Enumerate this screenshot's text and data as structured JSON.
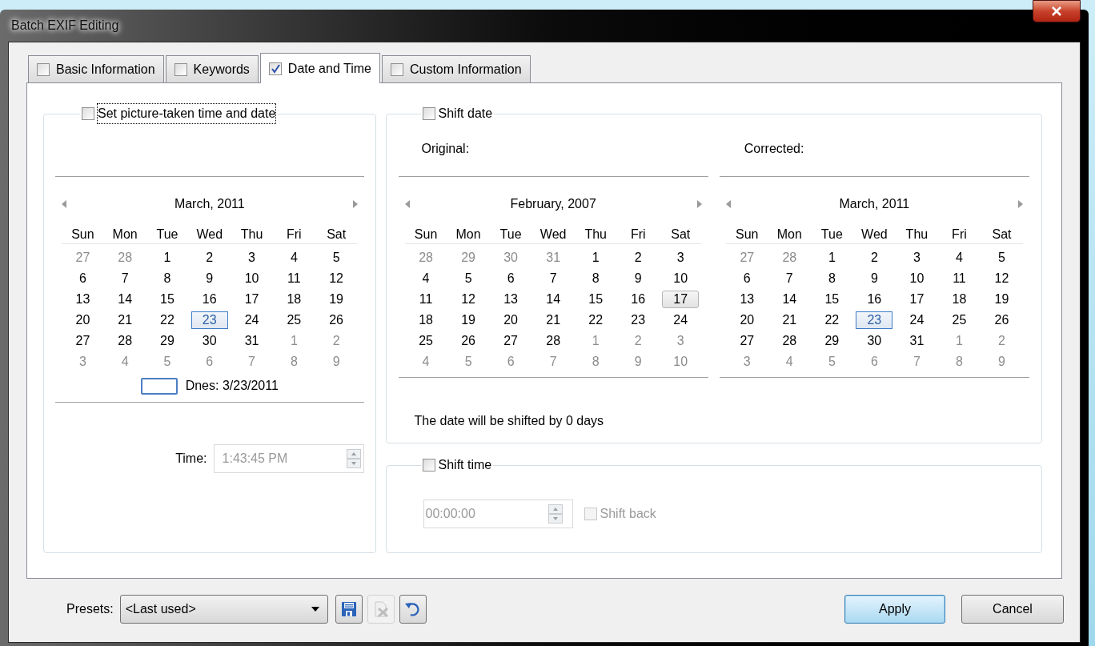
{
  "window": {
    "title": "Batch EXIF Editing"
  },
  "tabs": [
    {
      "label": "Basic Information",
      "checked": false,
      "selected": false
    },
    {
      "label": "Keywords",
      "checked": false,
      "selected": false
    },
    {
      "label": "Date and Time",
      "checked": true,
      "selected": true
    },
    {
      "label": "Custom Information",
      "checked": false,
      "selected": false
    }
  ],
  "set_date_group": {
    "label": "Set picture-taken time and date",
    "checked": false,
    "focused": true,
    "calendar": {
      "title": "March, 2011",
      "weekdays": [
        "Sun",
        "Mon",
        "Tue",
        "Wed",
        "Thu",
        "Fri",
        "Sat"
      ],
      "today_label": "Dnes: 3/23/2011",
      "weeks": [
        [
          {
            "text": "27",
            "muted": true,
            "selected": false,
            "today": false
          },
          {
            "text": "28",
            "muted": true,
            "selected": false,
            "today": false
          },
          {
            "text": "1",
            "muted": false,
            "selected": false,
            "today": false
          },
          {
            "text": "2",
            "muted": false,
            "selected": false,
            "today": false
          },
          {
            "text": "3",
            "muted": false,
            "selected": false,
            "today": false
          },
          {
            "text": "4",
            "muted": false,
            "selected": false,
            "today": false
          },
          {
            "text": "5",
            "muted": false,
            "selected": false,
            "today": false
          }
        ],
        [
          {
            "text": "6",
            "muted": false,
            "selected": false,
            "today": false
          },
          {
            "text": "7",
            "muted": false,
            "selected": false,
            "today": false
          },
          {
            "text": "8",
            "muted": false,
            "selected": false,
            "today": false
          },
          {
            "text": "9",
            "muted": false,
            "selected": false,
            "today": false
          },
          {
            "text": "10",
            "muted": false,
            "selected": false,
            "today": false
          },
          {
            "text": "11",
            "muted": false,
            "selected": false,
            "today": false
          },
          {
            "text": "12",
            "muted": false,
            "selected": false,
            "today": false
          }
        ],
        [
          {
            "text": "13",
            "muted": false,
            "selected": false,
            "today": false
          },
          {
            "text": "14",
            "muted": false,
            "selected": false,
            "today": false
          },
          {
            "text": "15",
            "muted": false,
            "selected": false,
            "today": false
          },
          {
            "text": "16",
            "muted": false,
            "selected": false,
            "today": false
          },
          {
            "text": "17",
            "muted": false,
            "selected": false,
            "today": false
          },
          {
            "text": "18",
            "muted": false,
            "selected": false,
            "today": false
          },
          {
            "text": "19",
            "muted": false,
            "selected": false,
            "today": false
          }
        ],
        [
          {
            "text": "20",
            "muted": false,
            "selected": false,
            "today": false
          },
          {
            "text": "21",
            "muted": false,
            "selected": false,
            "today": false
          },
          {
            "text": "22",
            "muted": false,
            "selected": false,
            "today": false
          },
          {
            "text": "23",
            "muted": false,
            "selected": true,
            "today": true
          },
          {
            "text": "24",
            "muted": false,
            "selected": false,
            "today": false
          },
          {
            "text": "25",
            "muted": false,
            "selected": false,
            "today": false
          },
          {
            "text": "26",
            "muted": false,
            "selected": false,
            "today": false
          }
        ],
        [
          {
            "text": "27",
            "muted": false,
            "selected": false,
            "today": false
          },
          {
            "text": "28",
            "muted": false,
            "selected": false,
            "today": false
          },
          {
            "text": "29",
            "muted": false,
            "selected": false,
            "today": false
          },
          {
            "text": "30",
            "muted": false,
            "selected": false,
            "today": false
          },
          {
            "text": "31",
            "muted": false,
            "selected": false,
            "today": false
          },
          {
            "text": "1",
            "muted": true,
            "selected": false,
            "today": false
          },
          {
            "text": "2",
            "muted": true,
            "selected": false,
            "today": false
          }
        ],
        [
          {
            "text": "3",
            "muted": true,
            "selected": false,
            "today": false
          },
          {
            "text": "4",
            "muted": true,
            "selected": false,
            "today": false
          },
          {
            "text": "5",
            "muted": true,
            "selected": false,
            "today": false
          },
          {
            "text": "6",
            "muted": true,
            "selected": false,
            "today": false
          },
          {
            "text": "7",
            "muted": true,
            "selected": false,
            "today": false
          },
          {
            "text": "8",
            "muted": true,
            "selected": false,
            "today": false
          },
          {
            "text": "9",
            "muted": true,
            "selected": false,
            "today": false
          }
        ]
      ]
    },
    "time": {
      "label": "Time:",
      "value": "1:43:45 PM",
      "disabled": true
    }
  },
  "shift_date_group": {
    "label": "Shift date",
    "checked": false,
    "original_label": "Original:",
    "corrected_label": "Corrected:",
    "original_calendar": {
      "title": "February, 2007",
      "weekdays": [
        "Sun",
        "Mon",
        "Tue",
        "Wed",
        "Thu",
        "Fri",
        "Sat"
      ],
      "weeks": [
        [
          {
            "text": "28",
            "muted": true,
            "selected": false,
            "today": false
          },
          {
            "text": "29",
            "muted": true,
            "selected": false,
            "today": false
          },
          {
            "text": "30",
            "muted": true,
            "selected": false,
            "today": false
          },
          {
            "text": "31",
            "muted": true,
            "selected": false,
            "today": false
          },
          {
            "text": "1",
            "muted": false,
            "selected": false,
            "today": false
          },
          {
            "text": "2",
            "muted": false,
            "selected": false,
            "today": false
          },
          {
            "text": "3",
            "muted": false,
            "selected": false,
            "today": false
          }
        ],
        [
          {
            "text": "4",
            "muted": false,
            "selected": false,
            "today": false
          },
          {
            "text": "5",
            "muted": false,
            "selected": false,
            "today": false
          },
          {
            "text": "6",
            "muted": false,
            "selected": false,
            "today": false
          },
          {
            "text": "7",
            "muted": false,
            "selected": false,
            "today": false
          },
          {
            "text": "8",
            "muted": false,
            "selected": false,
            "today": false
          },
          {
            "text": "9",
            "muted": false,
            "selected": false,
            "today": false
          },
          {
            "text": "10",
            "muted": false,
            "selected": false,
            "today": false
          }
        ],
        [
          {
            "text": "11",
            "muted": false,
            "selected": false,
            "today": false
          },
          {
            "text": "12",
            "muted": false,
            "selected": false,
            "today": false
          },
          {
            "text": "13",
            "muted": false,
            "selected": false,
            "today": false
          },
          {
            "text": "14",
            "muted": false,
            "selected": false,
            "today": false
          },
          {
            "text": "15",
            "muted": false,
            "selected": false,
            "today": false
          },
          {
            "text": "16",
            "muted": false,
            "selected": false,
            "today": false
          },
          {
            "text": "17",
            "muted": false,
            "selected": true,
            "today": false
          }
        ],
        [
          {
            "text": "18",
            "muted": false,
            "selected": false,
            "today": false
          },
          {
            "text": "19",
            "muted": false,
            "selected": false,
            "today": false
          },
          {
            "text": "20",
            "muted": false,
            "selected": false,
            "today": false
          },
          {
            "text": "21",
            "muted": false,
            "selected": false,
            "today": false
          },
          {
            "text": "22",
            "muted": false,
            "selected": false,
            "today": false
          },
          {
            "text": "23",
            "muted": false,
            "selected": false,
            "today": false
          },
          {
            "text": "24",
            "muted": false,
            "selected": false,
            "today": false
          }
        ],
        [
          {
            "text": "25",
            "muted": false,
            "selected": false,
            "today": false
          },
          {
            "text": "26",
            "muted": false,
            "selected": false,
            "today": false
          },
          {
            "text": "27",
            "muted": false,
            "selected": false,
            "today": false
          },
          {
            "text": "28",
            "muted": false,
            "selected": false,
            "today": false
          },
          {
            "text": "1",
            "muted": true,
            "selected": false,
            "today": false
          },
          {
            "text": "2",
            "muted": true,
            "selected": false,
            "today": false
          },
          {
            "text": "3",
            "muted": true,
            "selected": false,
            "today": false
          }
        ],
        [
          {
            "text": "4",
            "muted": true,
            "selected": false,
            "today": false
          },
          {
            "text": "5",
            "muted": true,
            "selected": false,
            "today": false
          },
          {
            "text": "6",
            "muted": true,
            "selected": false,
            "today": false
          },
          {
            "text": "7",
            "muted": true,
            "selected": false,
            "today": false
          },
          {
            "text": "8",
            "muted": true,
            "selected": false,
            "today": false
          },
          {
            "text": "9",
            "muted": true,
            "selected": false,
            "today": false
          },
          {
            "text": "10",
            "muted": true,
            "selected": false,
            "today": false
          }
        ]
      ]
    },
    "corrected_calendar": {
      "title": "March, 2011",
      "weekdays": [
        "Sun",
        "Mon",
        "Tue",
        "Wed",
        "Thu",
        "Fri",
        "Sat"
      ],
      "weeks": [
        [
          {
            "text": "27",
            "muted": true,
            "selected": false,
            "today": false
          },
          {
            "text": "28",
            "muted": true,
            "selected": false,
            "today": false
          },
          {
            "text": "1",
            "muted": false,
            "selected": false,
            "today": false
          },
          {
            "text": "2",
            "muted": false,
            "selected": false,
            "today": false
          },
          {
            "text": "3",
            "muted": false,
            "selected": false,
            "today": false
          },
          {
            "text": "4",
            "muted": false,
            "selected": false,
            "today": false
          },
          {
            "text": "5",
            "muted": false,
            "selected": false,
            "today": false
          }
        ],
        [
          {
            "text": "6",
            "muted": false,
            "selected": false,
            "today": false
          },
          {
            "text": "7",
            "muted": false,
            "selected": false,
            "today": false
          },
          {
            "text": "8",
            "muted": false,
            "selected": false,
            "today": false
          },
          {
            "text": "9",
            "muted": false,
            "selected": false,
            "today": false
          },
          {
            "text": "10",
            "muted": false,
            "selected": false,
            "today": false
          },
          {
            "text": "11",
            "muted": false,
            "selected": false,
            "today": false
          },
          {
            "text": "12",
            "muted": false,
            "selected": false,
            "today": false
          }
        ],
        [
          {
            "text": "13",
            "muted": false,
            "selected": false,
            "today": false
          },
          {
            "text": "14",
            "muted": false,
            "selected": false,
            "today": false
          },
          {
            "text": "15",
            "muted": false,
            "selected": false,
            "today": false
          },
          {
            "text": "16",
            "muted": false,
            "selected": false,
            "today": false
          },
          {
            "text": "17",
            "muted": false,
            "selected": false,
            "today": false
          },
          {
            "text": "18",
            "muted": false,
            "selected": false,
            "today": false
          },
          {
            "text": "19",
            "muted": false,
            "selected": false,
            "today": false
          }
        ],
        [
          {
            "text": "20",
            "muted": false,
            "selected": false,
            "today": false
          },
          {
            "text": "21",
            "muted": false,
            "selected": false,
            "today": false
          },
          {
            "text": "22",
            "muted": false,
            "selected": false,
            "today": false
          },
          {
            "text": "23",
            "muted": false,
            "selected": true,
            "today": true
          },
          {
            "text": "24",
            "muted": false,
            "selected": false,
            "today": false
          },
          {
            "text": "25",
            "muted": false,
            "selected": false,
            "today": false
          },
          {
            "text": "26",
            "muted": false,
            "selected": false,
            "today": false
          }
        ],
        [
          {
            "text": "27",
            "muted": false,
            "selected": false,
            "today": false
          },
          {
            "text": "28",
            "muted": false,
            "selected": false,
            "today": false
          },
          {
            "text": "29",
            "muted": false,
            "selected": false,
            "today": false
          },
          {
            "text": "30",
            "muted": false,
            "selected": false,
            "today": false
          },
          {
            "text": "31",
            "muted": false,
            "selected": false,
            "today": false
          },
          {
            "text": "1",
            "muted": true,
            "selected": false,
            "today": false
          },
          {
            "text": "2",
            "muted": true,
            "selected": false,
            "today": false
          }
        ],
        [
          {
            "text": "3",
            "muted": true,
            "selected": false,
            "today": false
          },
          {
            "text": "4",
            "muted": true,
            "selected": false,
            "today": false
          },
          {
            "text": "5",
            "muted": true,
            "selected": false,
            "today": false
          },
          {
            "text": "6",
            "muted": true,
            "selected": false,
            "today": false
          },
          {
            "text": "7",
            "muted": true,
            "selected": false,
            "today": false
          },
          {
            "text": "8",
            "muted": true,
            "selected": false,
            "today": false
          },
          {
            "text": "9",
            "muted": true,
            "selected": false,
            "today": false
          }
        ]
      ]
    },
    "message": "The date will be shifted by 0 days"
  },
  "shift_time_group": {
    "label": "Shift time",
    "checked": false,
    "value": "00:00:00",
    "disabled": true,
    "shift_back": {
      "label": "Shift back",
      "checked": false,
      "disabled": true
    }
  },
  "footer": {
    "presets_label": "Presets:",
    "preset_value": "<Last used>",
    "tools": [
      {
        "kind": "save",
        "disabled": false
      },
      {
        "kind": "delete",
        "disabled": true
      },
      {
        "kind": "revert",
        "disabled": false
      }
    ],
    "buttons": [
      {
        "label": "Apply",
        "default": true
      },
      {
        "label": "Cancel",
        "default": false
      }
    ]
  }
}
